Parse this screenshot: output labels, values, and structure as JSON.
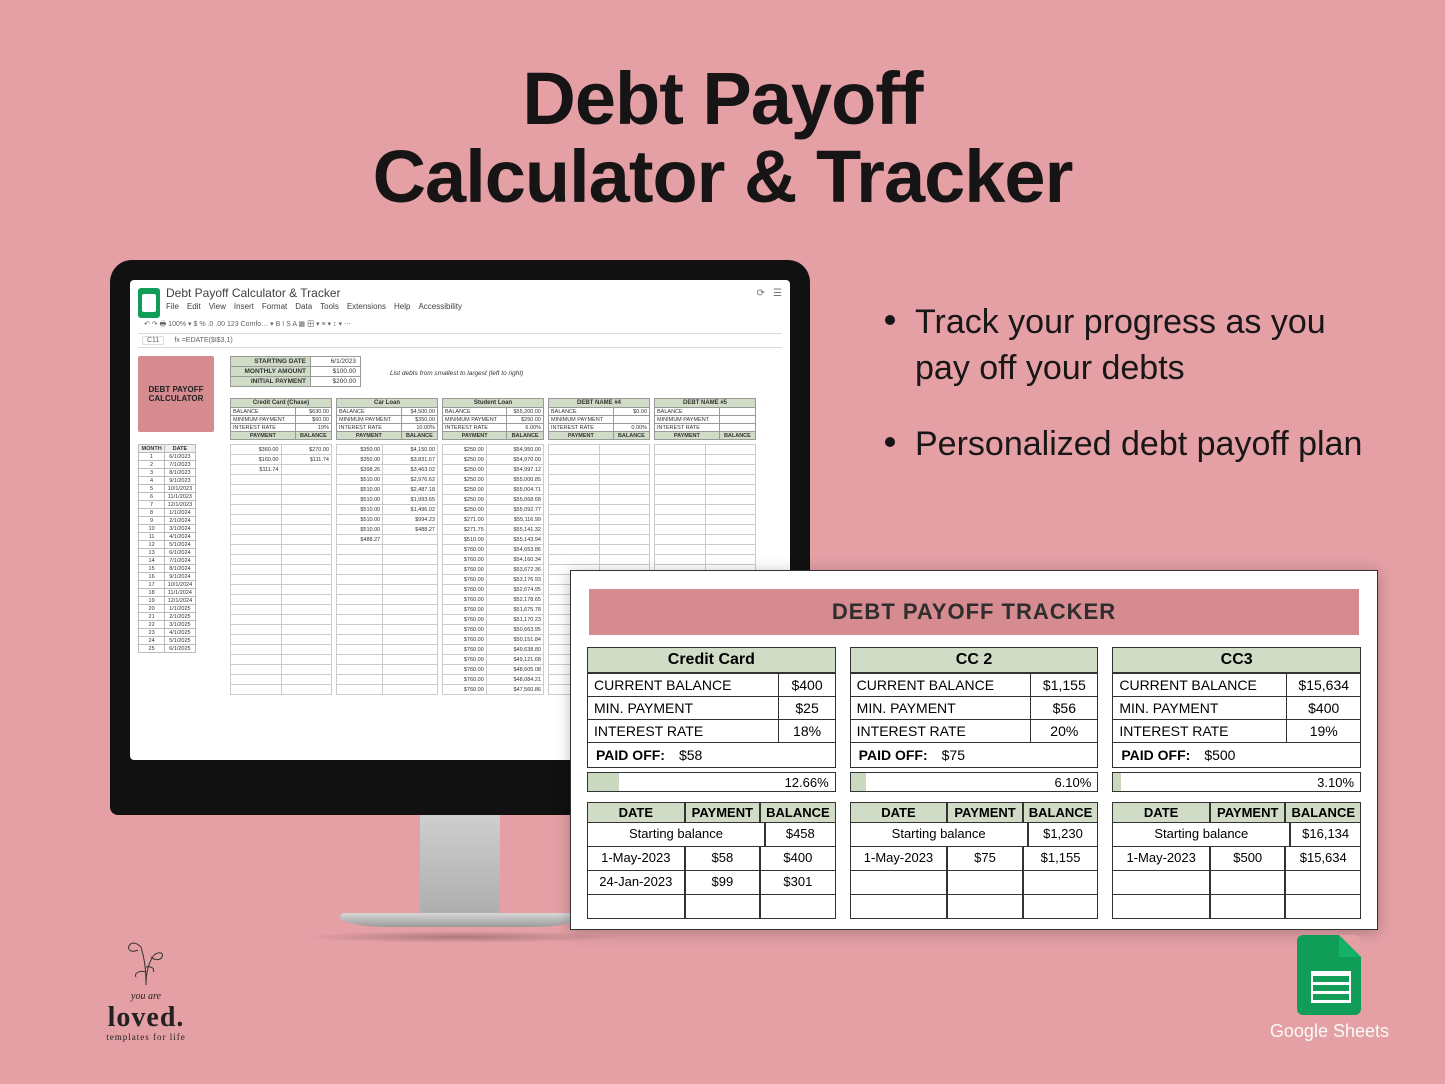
{
  "headline": {
    "line1": "Debt Payoff",
    "line2": "Calculator & Tracker"
  },
  "bullets": [
    "Track your progress as you pay off your debts",
    "Personalized debt payoff plan"
  ],
  "sheets": {
    "doc_title": "Debt Payoff Calculator & Tracker",
    "menus": [
      "File",
      "Edit",
      "View",
      "Insert",
      "Format",
      "Data",
      "Tools",
      "Extensions",
      "Help",
      "Accessibility"
    ],
    "toolbar": "↶  ↷  🖶  100% ▾   $  %  .0  .00  123  Comfo… ▾  B  I  S  A  ▦  田 ▾  ≡ ▾  ↕ ▾  ⋯",
    "cell_ref": "C11",
    "formula": "fx  =EDATE($I$3,1)",
    "badge": "DEBT PAYOFF\nCALCULATOR",
    "inputs": [
      [
        "STARTING DATE",
        "6/1/2023"
      ],
      [
        "MONTHLY AMOUNT",
        "$100.00"
      ],
      [
        "INITIAL PAYMENT",
        "$200.00"
      ]
    ],
    "hint": "List debts from smallest to largest (left to right)",
    "debt_headers": [
      {
        "name": "Credit Card (Chase)",
        "balance": "$630.00",
        "min": "$60.00",
        "rate": "19%"
      },
      {
        "name": "Car Loan",
        "balance": "$4,500.00",
        "min": "$350.00",
        "rate": "10.00%"
      },
      {
        "name": "Student Loan",
        "balance": "$55,200.00",
        "min": "$250.00",
        "rate": "6.00%"
      },
      {
        "name": "DEBT NAME #4",
        "balance": "$0.00",
        "min": "",
        "rate": "0.00%"
      },
      {
        "name": "DEBT NAME #5",
        "balance": "",
        "min": "",
        "rate": ""
      }
    ],
    "field_labels": {
      "balance": "BALANCE",
      "min": "MINIMUM PAYMENT",
      "rate": "INTEREST RATE",
      "payment": "PAYMENT",
      "month": "MONTH",
      "date": "DATE"
    },
    "months": [
      [
        "1",
        "6/1/2023"
      ],
      [
        "2",
        "7/1/2023"
      ],
      [
        "3",
        "8/1/2023"
      ],
      [
        "4",
        "9/1/2023"
      ],
      [
        "5",
        "10/1/2023"
      ],
      [
        "6",
        "11/1/2023"
      ],
      [
        "7",
        "12/1/2023"
      ],
      [
        "8",
        "1/1/2024"
      ],
      [
        "9",
        "2/1/2024"
      ],
      [
        "10",
        "3/1/2024"
      ],
      [
        "11",
        "4/1/2024"
      ],
      [
        "12",
        "5/1/2024"
      ],
      [
        "13",
        "6/1/2024"
      ],
      [
        "14",
        "7/1/2024"
      ],
      [
        "15",
        "8/1/2024"
      ],
      [
        "16",
        "9/1/2024"
      ],
      [
        "17",
        "10/1/2024"
      ],
      [
        "18",
        "11/1/2024"
      ],
      [
        "19",
        "12/1/2024"
      ],
      [
        "20",
        "1/1/2025"
      ],
      [
        "21",
        "2/1/2025"
      ],
      [
        "22",
        "3/1/2025"
      ],
      [
        "23",
        "4/1/2025"
      ],
      [
        "24",
        "5/1/2025"
      ],
      [
        "25",
        "6/1/2025"
      ]
    ],
    "schedule": [
      [
        [
          "$360.00",
          "$270.00"
        ],
        [
          "$160.00",
          "$111.74"
        ],
        [
          "$111.74",
          ""
        ],
        [
          "",
          ""
        ],
        [
          "",
          ""
        ],
        [
          "",
          ""
        ],
        [
          "",
          ""
        ],
        [
          "",
          ""
        ],
        [
          "",
          ""
        ],
        [
          "",
          ""
        ],
        [
          "",
          ""
        ],
        [
          "",
          ""
        ],
        [
          "",
          ""
        ],
        [
          "",
          ""
        ],
        [
          "",
          ""
        ],
        [
          "",
          ""
        ],
        [
          "",
          ""
        ],
        [
          "",
          ""
        ],
        [
          "",
          ""
        ],
        [
          "",
          ""
        ],
        [
          "",
          ""
        ],
        [
          "",
          ""
        ],
        [
          "",
          ""
        ],
        [
          "",
          ""
        ],
        [
          "",
          ""
        ]
      ],
      [
        [
          "$350.00",
          "$4,150.00"
        ],
        [
          "$350.00",
          "$3,831.67"
        ],
        [
          "$398.26",
          "$3,463.02"
        ],
        [
          "$510.00",
          "$2,976.62"
        ],
        [
          "$510.00",
          "$2,487.18"
        ],
        [
          "$510.00",
          "$1,993.65"
        ],
        [
          "$510.00",
          "$1,496.02"
        ],
        [
          "$510.00",
          "$994.23"
        ],
        [
          "$510.00",
          "$488.27"
        ],
        [
          "$488.27",
          ""
        ],
        [
          "",
          ""
        ],
        [
          "",
          ""
        ],
        [
          "",
          ""
        ],
        [
          "",
          ""
        ],
        [
          "",
          ""
        ],
        [
          "",
          ""
        ],
        [
          "",
          ""
        ],
        [
          "",
          ""
        ],
        [
          "",
          ""
        ],
        [
          "",
          ""
        ],
        [
          "",
          ""
        ],
        [
          "",
          ""
        ],
        [
          "",
          ""
        ],
        [
          "",
          ""
        ],
        [
          "",
          ""
        ]
      ],
      [
        [
          "$250.00",
          "$54,950.00"
        ],
        [
          "$250.00",
          "$54,970.00"
        ],
        [
          "$250.00",
          "$54,997.12"
        ],
        [
          "$250.00",
          "$55,000.85"
        ],
        [
          "$250.00",
          "$55,004.71"
        ],
        [
          "$250.00",
          "$55,068.68"
        ],
        [
          "$250.00",
          "$55,092.77"
        ],
        [
          "$271.00",
          "$55,116.99"
        ],
        [
          "$271.75",
          "$55,141.32"
        ],
        [
          "$510.00",
          "$55,143.94"
        ],
        [
          "$760.00",
          "$54,653.86"
        ],
        [
          "$760.00",
          "$54,160.34"
        ],
        [
          "$760.00",
          "$53,672.36"
        ],
        [
          "$760.00",
          "$53,176.93"
        ],
        [
          "$760.00",
          "$52,674.95"
        ],
        [
          "$760.00",
          "$52,178.65"
        ],
        [
          "$760.00",
          "$51,675.78"
        ],
        [
          "$760.00",
          "$51,170.23"
        ],
        [
          "$760.00",
          "$50,663.95"
        ],
        [
          "$760.00",
          "$50,151.84"
        ],
        [
          "$760.00",
          "$49,638.80"
        ],
        [
          "$760.00",
          "$49,121.68"
        ],
        [
          "$760.00",
          "$48,605.08"
        ],
        [
          "$760.00",
          "$48,084.21"
        ],
        [
          "$760.00",
          "$47,560.86"
        ]
      ]
    ]
  },
  "tracker": {
    "title": "DEBT PAYOFF TRACKER",
    "cols": [
      {
        "name": "Credit Card",
        "current": "$400",
        "min": "$25",
        "rate": "18%",
        "paid_label": "PAID OFF:",
        "paid": "$58",
        "pct": "12.66%",
        "bar": 12.66,
        "start": "$458",
        "rows": [
          [
            "1-May-2023",
            "$58",
            "$400"
          ],
          [
            "24-Jan-2023",
            "$99",
            "$301"
          ]
        ]
      },
      {
        "name": "CC 2",
        "current": "$1,155",
        "min": "$56",
        "rate": "20%",
        "paid_label": "PAID OFF:",
        "paid": "$75",
        "pct": "6.10%",
        "bar": 6.1,
        "start": "$1,230",
        "rows": [
          [
            "1-May-2023",
            "$75",
            "$1,155"
          ]
        ]
      },
      {
        "name": "CC3",
        "current": "$15,634",
        "min": "$400",
        "rate": "19%",
        "paid_label": "PAID OFF:",
        "paid": "$500",
        "pct": "3.10%",
        "bar": 3.1,
        "start": "$16,134",
        "rows": [
          [
            "1-May-2023",
            "$500",
            "$15,634"
          ]
        ]
      }
    ],
    "labels": {
      "current": "CURRENT BALANCE",
      "min": "MIN. PAYMENT",
      "rate": "INTEREST RATE",
      "date": "DATE",
      "payment": "PAYMENT",
      "balance": "BALANCE",
      "starting": "Starting balance"
    }
  },
  "brand": {
    "line1": "you are",
    "line2": "loved.",
    "line3": "templates for life"
  },
  "gs_badge": "Google Sheets"
}
